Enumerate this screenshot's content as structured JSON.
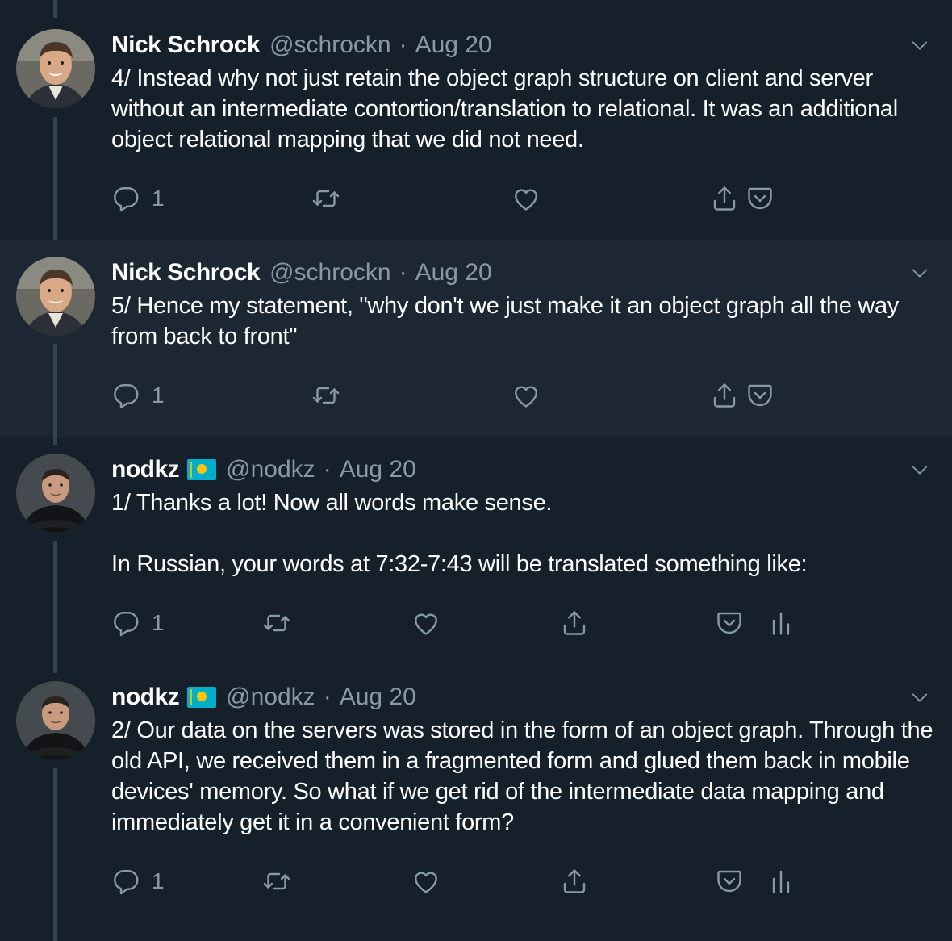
{
  "tweets": [
    {
      "author": "Nick Schrock",
      "handle": "@schrockn",
      "sep": "·",
      "date": "Aug 20",
      "text": "4/ Instead why not just retain the object graph structure on client and server without an intermediate contortion/translation to relational. It was an additional object relational mapping that we did not need.",
      "reply_count": "1"
    },
    {
      "author": "Nick Schrock",
      "handle": "@schrockn",
      "sep": "·",
      "date": "Aug 20",
      "text": "5/ Hence my statement, \"why don't we just make it an object graph all the way from back to front\"",
      "reply_count": "1"
    },
    {
      "author": "nodkz",
      "handle": "@nodkz",
      "sep": "·",
      "date": "Aug 20",
      "text": "1/ Thanks a lot! Now all words make sense.\n\nIn Russian, your words at 7:32-7:43 will be translated something like:",
      "reply_count": "1"
    },
    {
      "author": "nodkz",
      "handle": "@nodkz",
      "sep": "·",
      "date": "Aug 20",
      "text": "2/ Our data on the servers was stored in the form of an object graph. Through the old API, we received them in a fragmented form and glued them back in mobile devices' memory. So what if we get rid of the intermediate data mapping and immediately get it in a convenient form?",
      "reply_count": "1"
    }
  ],
  "colors": {
    "background": "#15202b",
    "highlight": "#1c2733",
    "secondary_text": "#8899a6",
    "thread_line": "#38444d"
  },
  "icons": [
    "reply-icon",
    "retweet-icon",
    "like-icon",
    "share-icon",
    "pocket-icon",
    "analytics-icon",
    "chevron-down-icon",
    "kazakhstan-flag-icon"
  ]
}
